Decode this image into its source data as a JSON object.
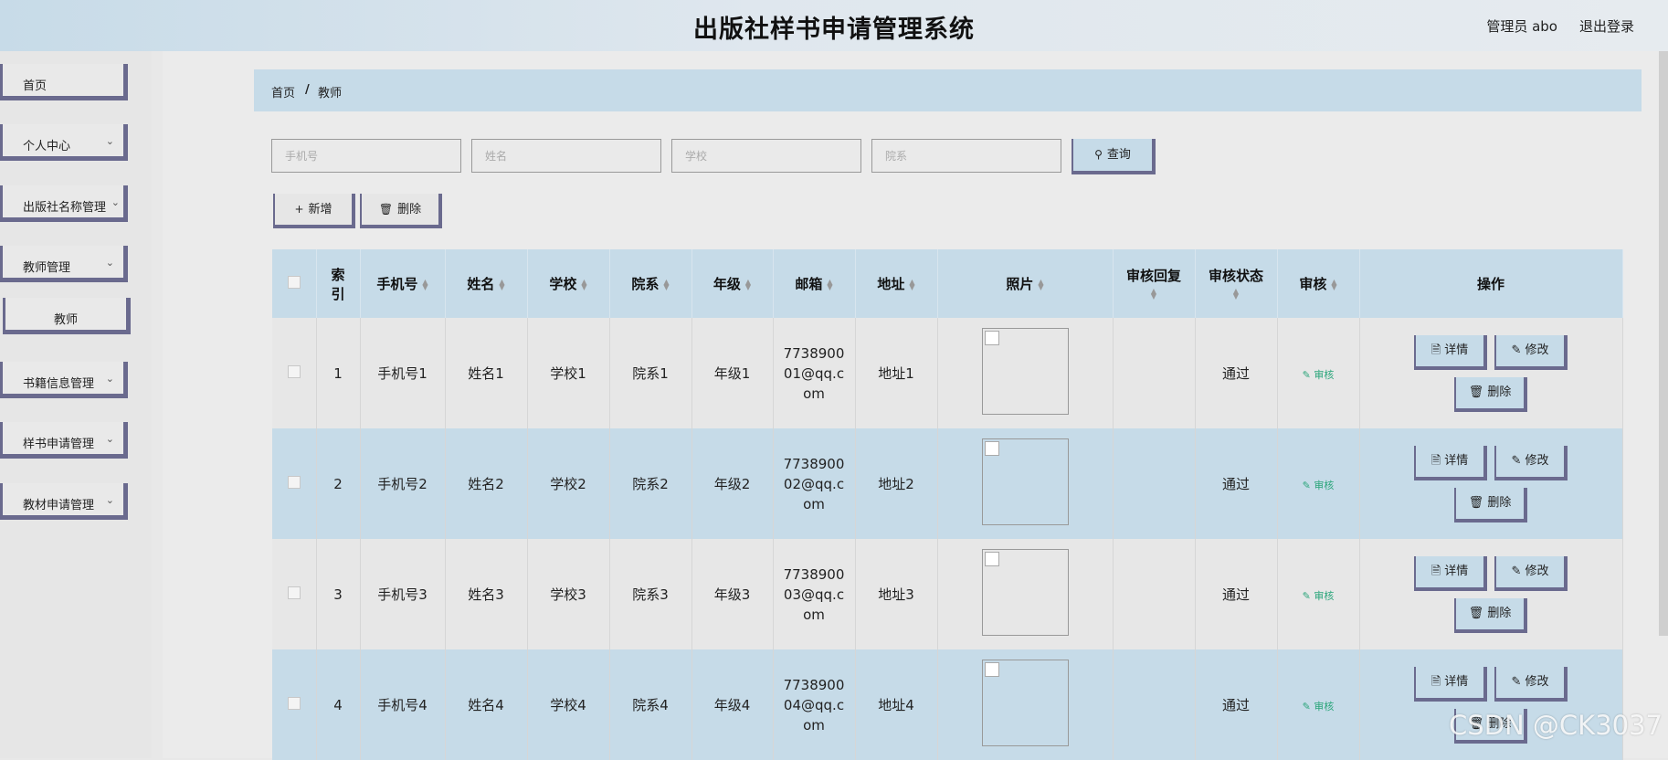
{
  "header": {
    "title": "出版社样书申请管理系统",
    "user": "管理员 abo",
    "logout": "退出登录"
  },
  "sidebar": {
    "items": [
      {
        "label": "首页",
        "has_chevron": false
      },
      {
        "label": "个人中心",
        "has_chevron": true
      },
      {
        "label": "出版社名称管理",
        "has_chevron": true
      },
      {
        "label": "教师管理",
        "has_chevron": true
      },
      {
        "label": "教师",
        "sub": true
      },
      {
        "label": "书籍信息管理",
        "has_chevron": true
      },
      {
        "label": "样书申请管理",
        "has_chevron": true
      },
      {
        "label": "教材申请管理",
        "has_chevron": true
      }
    ]
  },
  "breadcrumb": {
    "home": "首页",
    "sep": "/",
    "current": "教师"
  },
  "search": {
    "phone_placeholder": "手机号",
    "name_placeholder": "姓名",
    "school_placeholder": "学校",
    "dept_placeholder": "院系",
    "search_button": "查询"
  },
  "actions": {
    "add": "新增",
    "delete": "删除"
  },
  "table": {
    "headers": {
      "index": "索引",
      "phone": "手机号",
      "name": "姓名",
      "school": "学校",
      "dept": "院系",
      "grade": "年级",
      "email": "邮箱",
      "address": "地址",
      "photo": "照片",
      "reply": "审核回复",
      "status": "审核状态",
      "audit": "审核",
      "ops": "操作"
    },
    "rows": [
      {
        "index": "1",
        "phone": "手机号1",
        "name": "姓名1",
        "school": "学校1",
        "dept": "院系1",
        "grade": "年级1",
        "email": "773890001@qq.com",
        "address": "地址1",
        "reply": "",
        "status": "通过",
        "audit": "审核"
      },
      {
        "index": "2",
        "phone": "手机号2",
        "name": "姓名2",
        "school": "学校2",
        "dept": "院系2",
        "grade": "年级2",
        "email": "773890002@qq.com",
        "address": "地址2",
        "reply": "",
        "status": "通过",
        "audit": "审核"
      },
      {
        "index": "3",
        "phone": "手机号3",
        "name": "姓名3",
        "school": "学校3",
        "dept": "院系3",
        "grade": "年级3",
        "email": "773890003@qq.com",
        "address": "地址3",
        "reply": "",
        "status": "通过",
        "audit": "审核"
      },
      {
        "index": "4",
        "phone": "手机号4",
        "name": "姓名4",
        "school": "学校4",
        "dept": "院系4",
        "grade": "年级4",
        "email": "773890004@qq.com",
        "address": "地址4",
        "reply": "",
        "status": "通过",
        "audit": "审核"
      }
    ],
    "row_buttons": {
      "detail": "详情",
      "edit": "修改",
      "delete": "删除"
    }
  },
  "watermark": "CSDN @CK3037"
}
